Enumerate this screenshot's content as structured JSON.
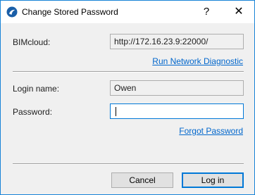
{
  "window": {
    "title": "Change Stored Password",
    "help_label": "?",
    "close_label": "✕",
    "accent": "#1883d7"
  },
  "server": {
    "label": "BIMcloud:",
    "value": "http://172.16.23.9:22000/",
    "diagnostic_link": "Run Network Diagnostic"
  },
  "login": {
    "name_label": "Login name:",
    "name_value": "Owen",
    "password_label": "Password:",
    "password_value": "",
    "forgot_link": "Forgot Password"
  },
  "buttons": {
    "cancel": "Cancel",
    "login": "Log in"
  },
  "colors": {
    "link": "#0066cc",
    "focus": "#0078d7"
  }
}
